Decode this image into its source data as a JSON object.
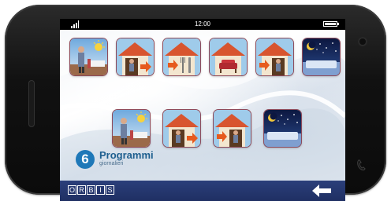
{
  "statusbar": {
    "time": "12:00"
  },
  "rows": [
    {
      "tiles": [
        {
          "icon": "person-by-bed-sun-icon"
        },
        {
          "icon": "house-person-exit-arrow-icon"
        },
        {
          "icon": "house-cutlery-icon"
        },
        {
          "icon": "house-armchair-icon"
        },
        {
          "icon": "house-person-enter-arrow-icon"
        },
        {
          "icon": "night-sleep-icon"
        }
      ]
    },
    {
      "tiles": [
        {
          "icon": "person-by-bed-sun-icon"
        },
        {
          "icon": "house-person-exit-arrow-icon"
        },
        {
          "icon": "house-person-enter-arrow-icon"
        },
        {
          "icon": "night-sleep-icon"
        }
      ]
    }
  ],
  "program": {
    "number": "6",
    "title": "Programmi",
    "subtitle": "giornalieri"
  },
  "footer": {
    "logo_letters": [
      "O",
      "R",
      "B",
      "I",
      "S"
    ],
    "back_icon": "back-arrow-icon"
  },
  "colors": {
    "bottom_bar": "#1f2f63",
    "badge": "#1e78b8",
    "tile_border": "#8e4a5a"
  }
}
